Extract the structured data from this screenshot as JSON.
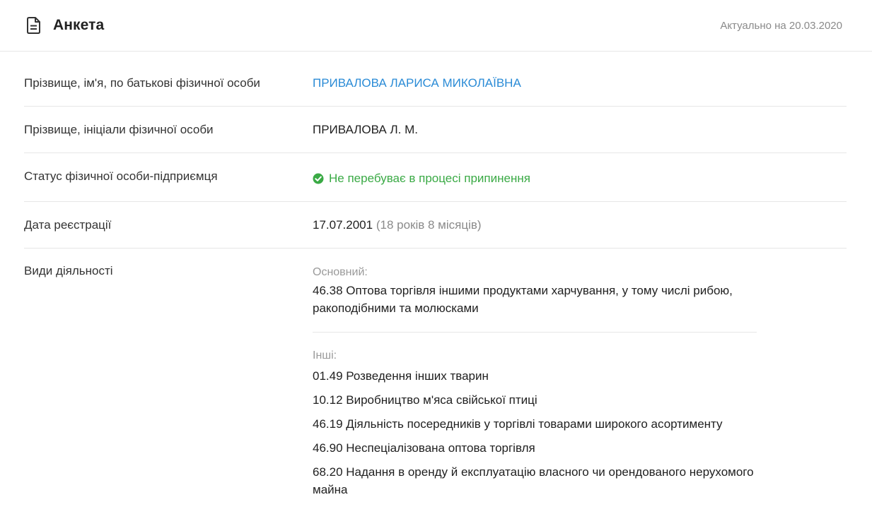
{
  "header": {
    "title": "Анкета",
    "icon": "document-icon",
    "updated": "Актуально на 20.03.2020"
  },
  "colors": {
    "link": "#2a8bd6",
    "status_ok": "#3aaa45",
    "muted": "#8a8a8a"
  },
  "rows": {
    "full_name": {
      "label": "Прізвище, ім'я, по батькові фізичної особи",
      "value": "ПРИВАЛОВА ЛАРИСА МИКОЛАЇВНА"
    },
    "short_name": {
      "label": "Прізвище, ініціали фізичної особи",
      "value": "ПРИВАЛОВА Л. М."
    },
    "status": {
      "label": "Статус фізичної особи-підприємця",
      "icon": "check-circle-icon",
      "value": "Не перебуває в процесі припинення"
    },
    "registration": {
      "label": "Дата реєстрації",
      "date": "17.07.2001",
      "age": "(18 років 8 місяців)"
    },
    "activities": {
      "label": "Види діяльності",
      "main_label": "Основний:",
      "main": "46.38 Оптова торгівля іншими продуктами харчування, у тому числі рибою, ракоподібними та молюсками",
      "others_label": "Інші:",
      "others": [
        "01.49 Розведення інших тварин",
        "10.12 Виробництво м'яса свійської птиці",
        "46.19 Діяльність посередників у торгівлі товарами широкого асортименту",
        "46.90 Неспеціалізована оптова торгівля",
        "68.20 Надання в оренду й експлуатацію власного чи орендованого нерухомого майна"
      ]
    }
  }
}
